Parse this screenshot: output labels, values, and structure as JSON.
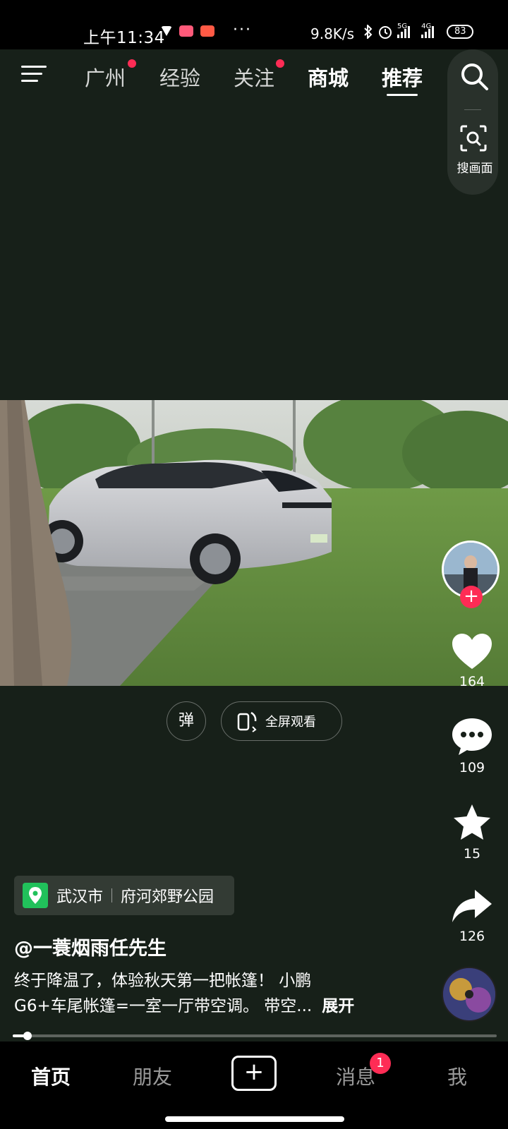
{
  "status_bar": {
    "time": "上午11:34",
    "more": "···",
    "speed": "9.8K/s",
    "net1": "5G",
    "net2": "4G",
    "battery": "83"
  },
  "top_tabs": [
    {
      "label": "广州",
      "dot": true
    },
    {
      "label": "经验",
      "dot": false
    },
    {
      "label": "关注",
      "dot": true
    },
    {
      "label": "商城",
      "dot": false
    },
    {
      "label": "推荐",
      "dot": false
    }
  ],
  "active_tab": "推荐",
  "search": {
    "scan_label": "搜画面"
  },
  "video_controls": {
    "danmu_label": "弹",
    "fullscreen_label": "全屏观看"
  },
  "actions": {
    "likes": "164",
    "comments": "109",
    "favorites": "15",
    "shares": "126"
  },
  "location": {
    "city": "武汉市",
    "place": "府河郊野公园"
  },
  "author": "@一蓑烟雨任先生",
  "caption": {
    "line1": "终于降温了，体验秋天第一把帐篷！ 小鹏",
    "line2": "G6+车尾帐篷=一室一厅带空调。 带空...",
    "expand": "展开"
  },
  "progress": 0.03,
  "bottom_nav": {
    "home": "首页",
    "friends": "朋友",
    "plus": "+",
    "messages": "消息",
    "messages_badge": "1",
    "me": "我"
  },
  "colors": {
    "background": "#172019",
    "accent": "#fe2c55",
    "location_pin": "#21c15b"
  }
}
